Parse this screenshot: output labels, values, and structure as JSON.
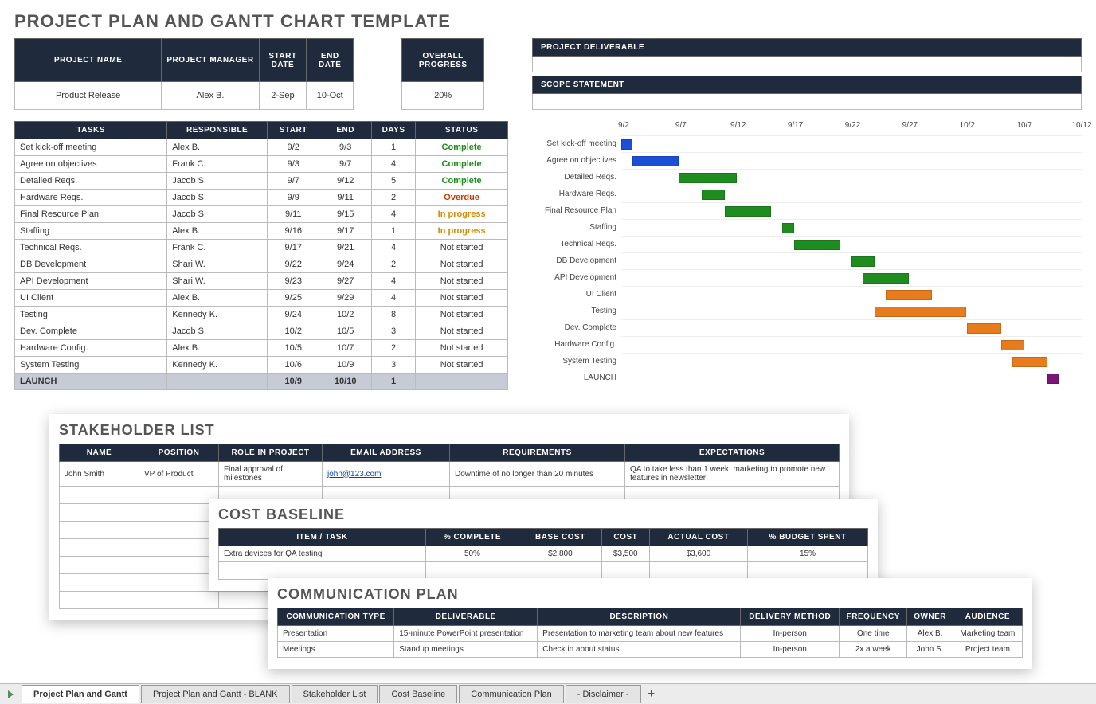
{
  "page_title": "PROJECT PLAN AND GANTT CHART TEMPLATE",
  "info_table": {
    "headers": [
      "PROJECT NAME",
      "PROJECT MANAGER",
      "START DATE",
      "END DATE"
    ],
    "values": [
      "Product Release",
      "Alex B.",
      "2-Sep",
      "10-Oct"
    ]
  },
  "progress": {
    "header": "OVERALL PROGRESS",
    "value": "20%"
  },
  "deliverable_header": "PROJECT DELIVERABLE",
  "scope_header": "SCOPE STATEMENT",
  "tasks": {
    "headers": [
      "TASKS",
      "RESPONSIBLE",
      "START",
      "END",
      "DAYS",
      "STATUS"
    ],
    "rows": [
      {
        "task": "Set kick-off meeting",
        "responsible": "Alex B.",
        "start": "9/2",
        "end": "9/3",
        "days": "1",
        "status": "Complete",
        "status_cls": "status-complete"
      },
      {
        "task": "Agree on objectives",
        "responsible": "Frank C.",
        "start": "9/3",
        "end": "9/7",
        "days": "4",
        "status": "Complete",
        "status_cls": "status-complete"
      },
      {
        "task": "Detailed Reqs.",
        "responsible": "Jacob S.",
        "start": "9/7",
        "end": "9/12",
        "days": "5",
        "status": "Complete",
        "status_cls": "status-complete"
      },
      {
        "task": "Hardware Reqs.",
        "responsible": "Jacob S.",
        "start": "9/9",
        "end": "9/11",
        "days": "2",
        "status": "Overdue",
        "status_cls": "status-overdue"
      },
      {
        "task": "Final Resource Plan",
        "responsible": "Jacob S.",
        "start": "9/11",
        "end": "9/15",
        "days": "4",
        "status": "In progress",
        "status_cls": "status-progress"
      },
      {
        "task": "Staffing",
        "responsible": "Alex B.",
        "start": "9/16",
        "end": "9/17",
        "days": "1",
        "status": "In progress",
        "status_cls": "status-progress"
      },
      {
        "task": "Technical Reqs.",
        "responsible": "Frank C.",
        "start": "9/17",
        "end": "9/21",
        "days": "4",
        "status": "Not started",
        "status_cls": ""
      },
      {
        "task": "DB Development",
        "responsible": "Shari W.",
        "start": "9/22",
        "end": "9/24",
        "days": "2",
        "status": "Not started",
        "status_cls": ""
      },
      {
        "task": "API Development",
        "responsible": "Shari W.",
        "start": "9/23",
        "end": "9/27",
        "days": "4",
        "status": "Not started",
        "status_cls": ""
      },
      {
        "task": "UI Client",
        "responsible": "Alex B.",
        "start": "9/25",
        "end": "9/29",
        "days": "4",
        "status": "Not started",
        "status_cls": ""
      },
      {
        "task": "Testing",
        "responsible": "Kennedy K.",
        "start": "9/24",
        "end": "10/2",
        "days": "8",
        "status": "Not started",
        "status_cls": ""
      },
      {
        "task": "Dev. Complete",
        "responsible": "Jacob S.",
        "start": "10/2",
        "end": "10/5",
        "days": "3",
        "status": "Not started",
        "status_cls": ""
      },
      {
        "task": "Hardware Config.",
        "responsible": "Alex B.",
        "start": "10/5",
        "end": "10/7",
        "days": "2",
        "status": "Not started",
        "status_cls": ""
      },
      {
        "task": "System Testing",
        "responsible": "Kennedy K.",
        "start": "10/6",
        "end": "10/9",
        "days": "3",
        "status": "Not started",
        "status_cls": ""
      },
      {
        "task": "LAUNCH",
        "responsible": "",
        "start": "10/9",
        "end": "10/10",
        "days": "1",
        "status": "",
        "status_cls": "",
        "launch": true
      }
    ]
  },
  "chart_data": {
    "type": "gantt",
    "x_start": "9/2",
    "x_end": "10/12",
    "ticks": [
      "9/2",
      "9/7",
      "9/12",
      "9/17",
      "9/22",
      "9/27",
      "10/2",
      "10/7",
      "10/12"
    ],
    "bars": [
      {
        "label": "Set kick-off meeting",
        "start": 0,
        "len": 1,
        "color": "blue"
      },
      {
        "label": "Agree on objectives",
        "start": 1,
        "len": 4,
        "color": "blue"
      },
      {
        "label": "Detailed Reqs.",
        "start": 5,
        "len": 5,
        "color": "green"
      },
      {
        "label": "Hardware Reqs.",
        "start": 7,
        "len": 2,
        "color": "green"
      },
      {
        "label": "Final Resource Plan",
        "start": 9,
        "len": 4,
        "color": "green"
      },
      {
        "label": "Staffing",
        "start": 14,
        "len": 1,
        "color": "green"
      },
      {
        "label": "Technical Reqs.",
        "start": 15,
        "len": 4,
        "color": "green"
      },
      {
        "label": "DB Development",
        "start": 20,
        "len": 2,
        "color": "green"
      },
      {
        "label": "API Development",
        "start": 21,
        "len": 4,
        "color": "green"
      },
      {
        "label": "UI Client",
        "start": 23,
        "len": 4,
        "color": "orange"
      },
      {
        "label": "Testing",
        "start": 22,
        "len": 8,
        "color": "orange"
      },
      {
        "label": "Dev. Complete",
        "start": 30,
        "len": 3,
        "color": "orange"
      },
      {
        "label": "Hardware Config.",
        "start": 33,
        "len": 2,
        "color": "orange"
      },
      {
        "label": "System Testing",
        "start": 34,
        "len": 3,
        "color": "orange"
      },
      {
        "label": "LAUNCH",
        "start": 37,
        "len": 1,
        "color": "purple"
      }
    ],
    "total_days": 40
  },
  "stakeholder": {
    "title": "STAKEHOLDER LIST",
    "headers": [
      "NAME",
      "POSITION",
      "ROLE IN PROJECT",
      "EMAIL ADDRESS",
      "REQUIREMENTS",
      "EXPECTATIONS"
    ],
    "row": {
      "name": "John Smith",
      "position": "VP of Product",
      "role": "Final approval of milestones",
      "email": "john@123.com",
      "reqs": "Downtime of no longer than 20 minutes",
      "exp": "QA to take less than 1 week, marketing to promote new features in newsletter"
    }
  },
  "cost": {
    "title": "COST BASELINE",
    "headers": [
      "ITEM / TASK",
      "% COMPLETE",
      "BASE COST",
      "COST",
      "ACTUAL COST",
      "% BUDGET SPENT"
    ],
    "row": [
      "Extra devices for QA testing",
      "50%",
      "$2,800",
      "$3,500",
      "$3,600",
      "15%"
    ]
  },
  "comm": {
    "title": "COMMUNICATION PLAN",
    "headers": [
      "COMMUNICATION TYPE",
      "DELIVERABLE",
      "DESCRIPTION",
      "DELIVERY METHOD",
      "FREQUENCY",
      "OWNER",
      "AUDIENCE"
    ],
    "rows": [
      [
        "Presentation",
        "15-minute PowerPoint presentation",
        "Presentation to marketing team about new features",
        "In-person",
        "One time",
        "Alex B.",
        "Marketing team"
      ],
      [
        "Meetings",
        "Standup meetings",
        "Check in about status",
        "In-person",
        "2x a week",
        "John S.",
        "Project team"
      ]
    ]
  },
  "tabs": [
    "Project Plan and Gantt",
    "Project Plan and Gantt - BLANK",
    "Stakeholder List",
    "Cost Baseline",
    "Communication Plan",
    "- Disclaimer -"
  ],
  "active_tab": 0,
  "add_tab": "+"
}
